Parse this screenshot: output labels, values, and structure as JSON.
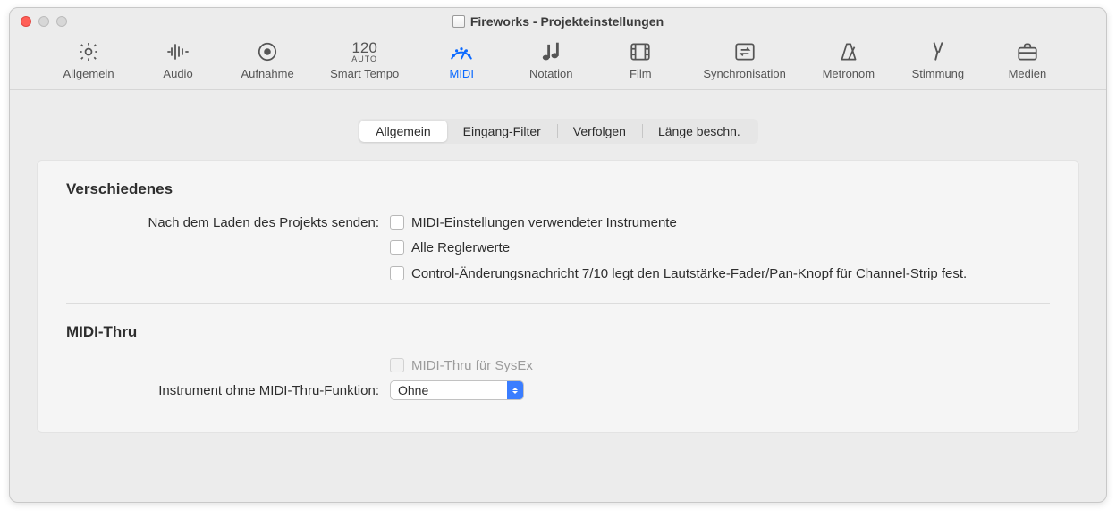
{
  "window": {
    "title": "Fireworks - Projekteinstellungen"
  },
  "toolbar": {
    "items": [
      {
        "id": "general",
        "label": "Allgemein",
        "icon": "gear-icon"
      },
      {
        "id": "audio",
        "label": "Audio",
        "icon": "waveform-icon"
      },
      {
        "id": "record",
        "label": "Aufnahme",
        "icon": "record-icon"
      },
      {
        "id": "smarttempo",
        "label": "Smart Tempo",
        "icon": "tempo-icon",
        "tempo": "120",
        "tempo_sub": "AUTO"
      },
      {
        "id": "midi",
        "label": "MIDI",
        "icon": "gauge-icon",
        "active": true
      },
      {
        "id": "notation",
        "label": "Notation",
        "icon": "notes-icon"
      },
      {
        "id": "film",
        "label": "Film",
        "icon": "film-icon"
      },
      {
        "id": "sync",
        "label": "Synchronisation",
        "icon": "sync-icon"
      },
      {
        "id": "metronome",
        "label": "Metronom",
        "icon": "metronome-icon"
      },
      {
        "id": "tuning",
        "label": "Stimmung",
        "icon": "tuningfork-icon"
      },
      {
        "id": "media",
        "label": "Medien",
        "icon": "briefcase-icon"
      }
    ]
  },
  "subtabs": {
    "items": [
      {
        "id": "allgemein",
        "label": "Allgemein",
        "active": true
      },
      {
        "id": "eingang",
        "label": "Eingang-Filter"
      },
      {
        "id": "verfolgen",
        "label": "Verfolgen"
      },
      {
        "id": "laenge",
        "label": "Länge beschn."
      }
    ]
  },
  "sections": {
    "misc": {
      "title": "Verschiedenes",
      "send_label": "Nach dem Laden des Projekts senden:",
      "checks": [
        {
          "label": "MIDI-Einstellungen verwendeter Instrumente",
          "checked": false
        },
        {
          "label": "Alle Reglerwerte",
          "checked": false
        },
        {
          "label": "Control-Änderungsnachricht 7/10 legt den Lautstärke-Fader/Pan-Knopf für Channel-Strip fest.",
          "checked": false
        }
      ]
    },
    "thru": {
      "title": "MIDI-Thru",
      "sysex": {
        "label": "MIDI-Thru für SysEx",
        "checked": false,
        "disabled": true
      },
      "instrument_label": "Instrument ohne MIDI-Thru-Funktion:",
      "instrument_value": "Ohne"
    }
  }
}
